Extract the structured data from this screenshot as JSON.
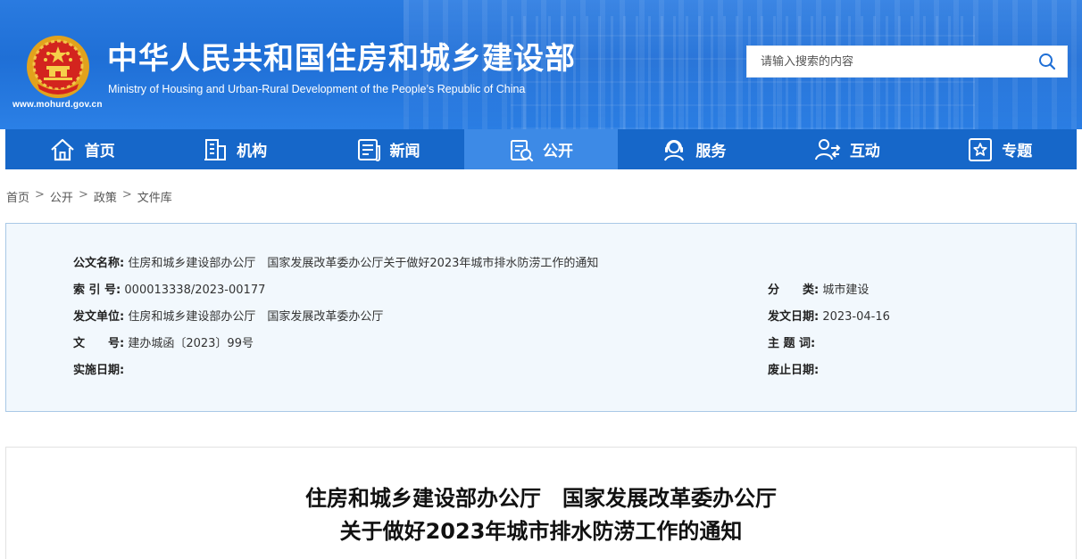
{
  "header": {
    "title_cn": "中华人民共和国住房和城乡建设部",
    "title_en": "Ministry of Housing and Urban-Rural Development of the People’s Republic of China",
    "site_url": "www.mohurd.gov.cn",
    "search_placeholder": "请输入搜索的内容",
    "colors": {
      "banner": "#1f6fd6",
      "nav": "#1667c9",
      "nav_active": "#3d8ae6"
    }
  },
  "nav": {
    "items": [
      {
        "label": "首页",
        "icon": "home-icon"
      },
      {
        "label": "机构",
        "icon": "building-icon"
      },
      {
        "label": "新闻",
        "icon": "news-icon"
      },
      {
        "label": "公开",
        "icon": "open-icon",
        "active": true
      },
      {
        "label": "服务",
        "icon": "service-icon"
      },
      {
        "label": "互动",
        "icon": "interact-icon"
      },
      {
        "label": "专题",
        "icon": "star-icon"
      }
    ]
  },
  "breadcrumb": {
    "items": [
      "首页",
      "公开",
      "政策",
      "文件库"
    ],
    "separator": ">"
  },
  "info": {
    "doc_name_label": "公文名称:",
    "doc_name": "住房和城乡建设部办公厅　国家发展改革委办公厅关于做好2023年城市排水防涝工作的通知",
    "index_label": "索 引 号:",
    "index": "000013338/2023-00177",
    "category_label": "分　　类:",
    "category": "城市建设",
    "issuer_label": "发文单位:",
    "issuer": "住房和城乡建设部办公厅　国家发展改革委办公厅",
    "date_label": "发文日期:",
    "date": "2023-04-16",
    "doc_no_label": "文　　号:",
    "doc_no": "建办城函〔2023〕99号",
    "keywords_label": "主 题 词:",
    "keywords": "",
    "effective_label": "实施日期:",
    "effective": "",
    "expiry_label": "废止日期:",
    "expiry": ""
  },
  "article": {
    "title_line1": "住房和城乡建设部办公厅　国家发展改革委办公厅",
    "title_line2": "关于做好2023年城市排水防涝工作的通知"
  }
}
